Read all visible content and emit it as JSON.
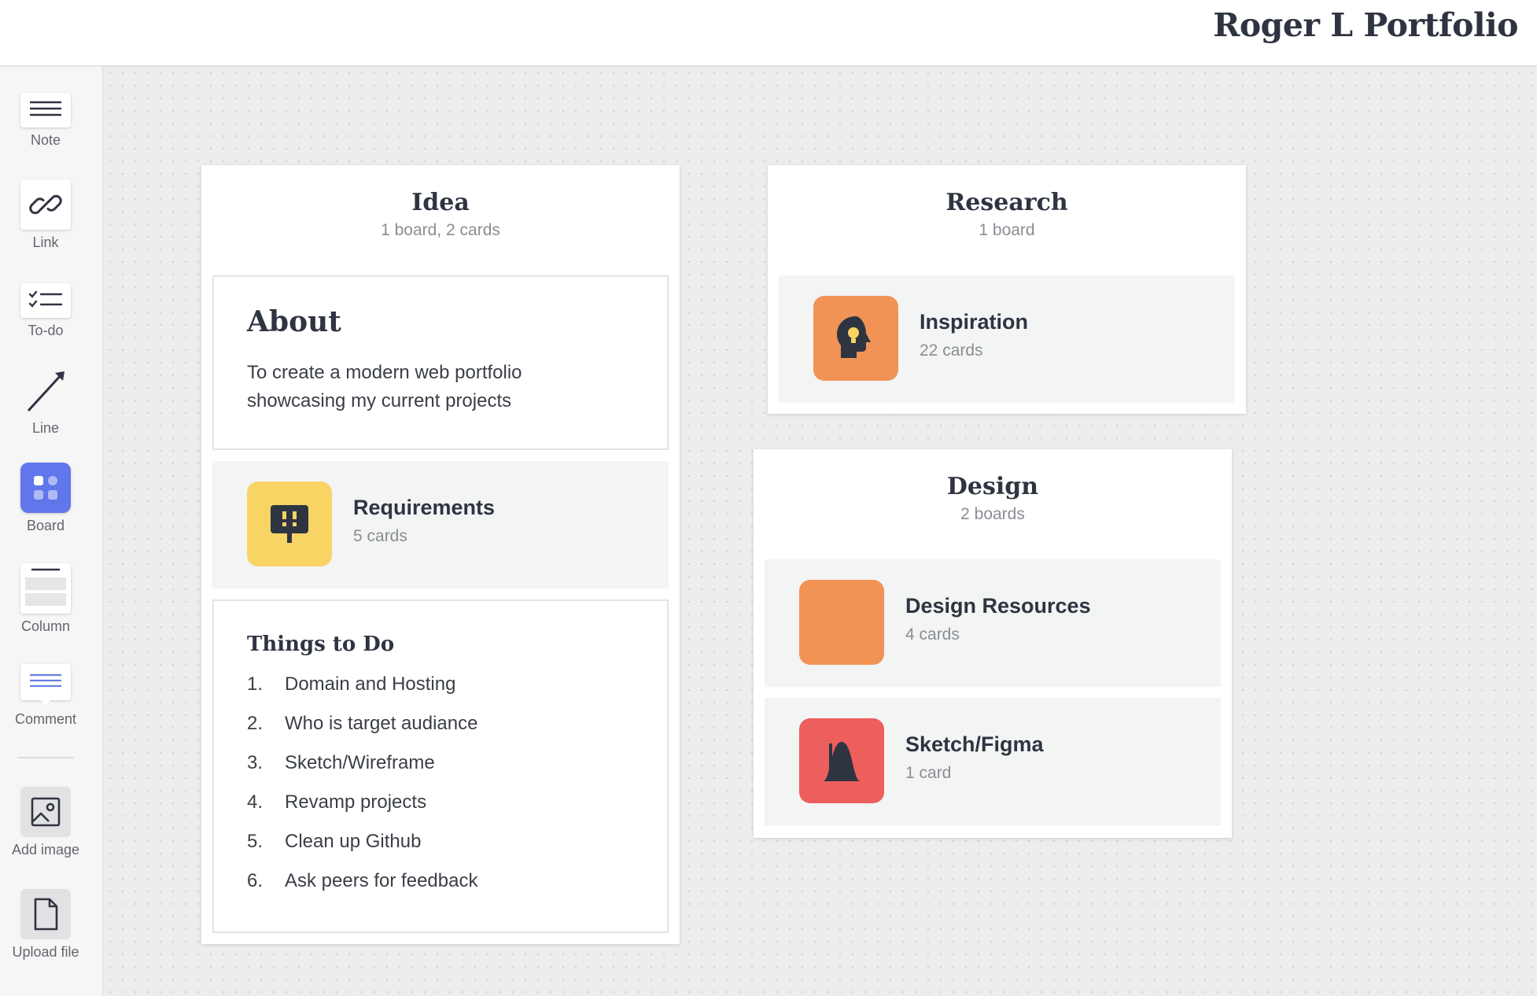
{
  "header": {
    "title": "Roger L Portfolio"
  },
  "sidebar": {
    "tools": [
      {
        "label": "Note",
        "icon": "note-icon"
      },
      {
        "label": "Link",
        "icon": "link-icon"
      },
      {
        "label": "To-do",
        "icon": "todo-icon"
      },
      {
        "label": "Line",
        "icon": "line-arrow-icon"
      },
      {
        "label": "Board",
        "icon": "board-icon"
      },
      {
        "label": "Column",
        "icon": "column-icon"
      },
      {
        "label": "Comment",
        "icon": "comment-icon"
      },
      {
        "label": "Add image",
        "icon": "image-icon"
      },
      {
        "label": "Upload file",
        "icon": "file-icon"
      }
    ]
  },
  "boards": {
    "idea": {
      "title": "Idea",
      "subtitle": "1 board, 2 cards",
      "about": {
        "heading": "About",
        "text": "To create a modern web portfolio showcasing my current projects"
      },
      "requirements": {
        "title": "Requirements",
        "count": "5 cards",
        "color": "#f8d465",
        "icon": "sign-icon"
      },
      "todo": {
        "heading": "Things to Do",
        "items": [
          {
            "num": "1.",
            "text": "Domain and Hosting"
          },
          {
            "num": "2.",
            "text": "Who is target audiance"
          },
          {
            "num": "3.",
            "text": "Sketch/Wireframe"
          },
          {
            "num": "4.",
            "text": "Revamp projects"
          },
          {
            "num": "5.",
            "text": "Clean up Github"
          },
          {
            "num": "6.",
            "text": "Ask peers for feedback"
          }
        ]
      }
    },
    "research": {
      "title": "Research",
      "subtitle": "1 board",
      "inspiration": {
        "title": "Inspiration",
        "count": "22 cards",
        "color": "#f09355",
        "icon": "head-lightbulb-icon"
      }
    },
    "design": {
      "title": "Design",
      "subtitle": "2 boards",
      "resources": {
        "title": "Design Resources",
        "count": "4 cards",
        "color": "#f09355"
      },
      "sketch": {
        "title": "Sketch/Figma",
        "count": "1 card",
        "color": "#ec5f5d",
        "icon": "curve-icon"
      }
    }
  }
}
